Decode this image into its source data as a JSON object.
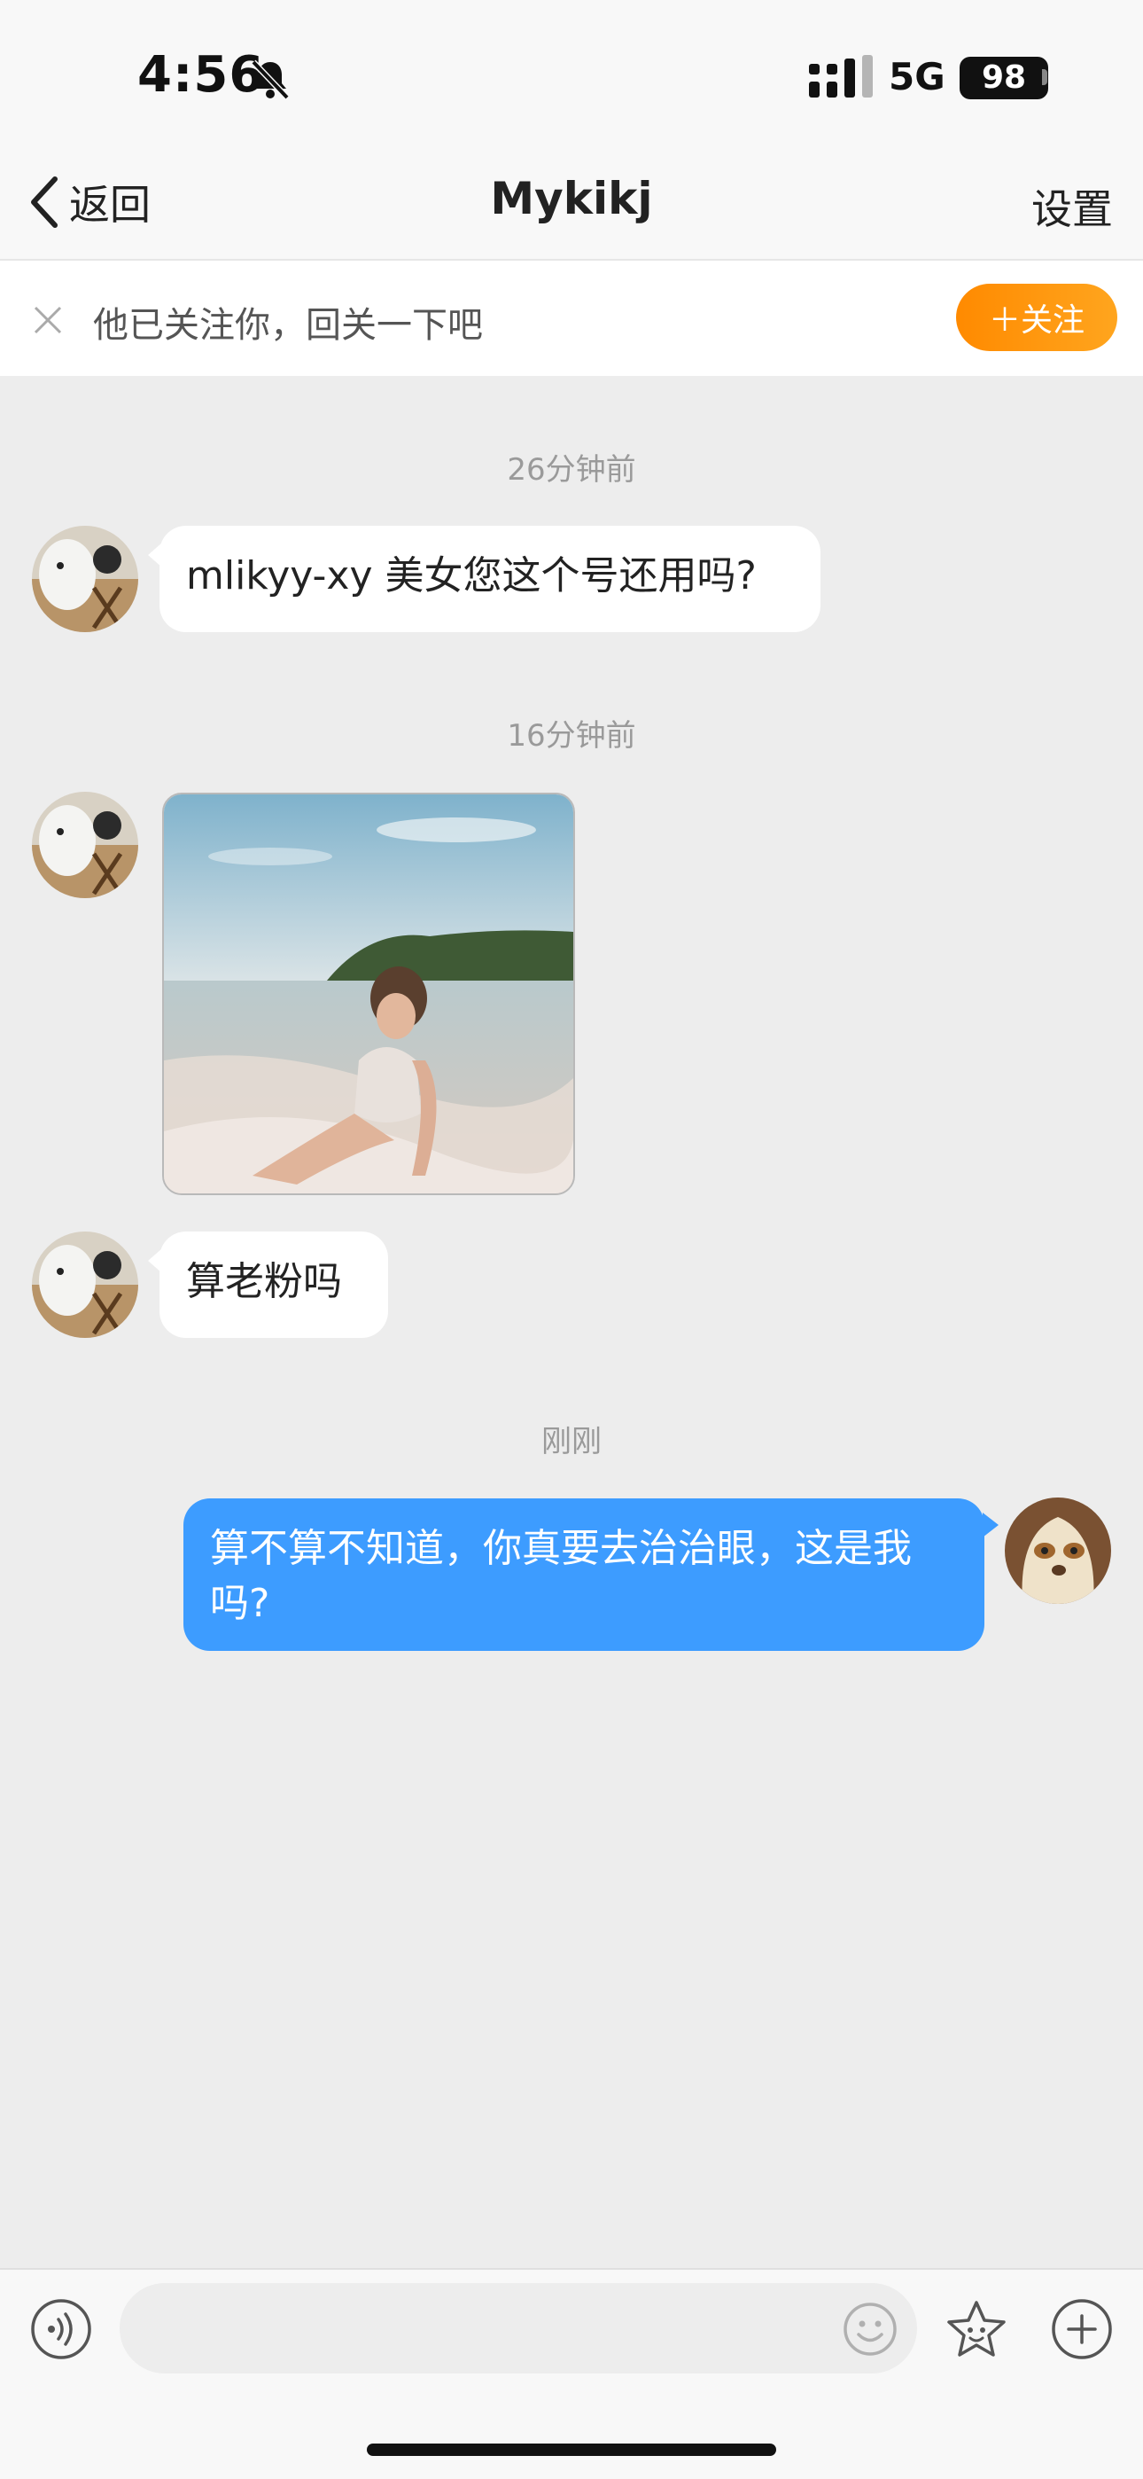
{
  "status_bar": {
    "time": "4:56",
    "network": "5G",
    "battery": "98"
  },
  "nav": {
    "back_label": "返回",
    "title": "Mykikj",
    "settings_label": "设置"
  },
  "follow_bar": {
    "text": "他已关注你，回关一下吧",
    "button_label": "＋关注"
  },
  "messages": [
    {
      "timestamp": "26分钟前"
    },
    {
      "from": "other",
      "type": "text",
      "text": "mlikyy-xy 美女您这个号还用吗?"
    },
    {
      "timestamp": "16分钟前"
    },
    {
      "from": "other",
      "type": "image"
    },
    {
      "from": "other",
      "type": "text",
      "text": "算老粉吗"
    },
    {
      "timestamp": "刚刚"
    },
    {
      "from": "me",
      "type": "text",
      "text": "算不算不知道，你真要去治治眼，这是我吗?"
    }
  ],
  "input": {
    "placeholder": ""
  },
  "colors": {
    "accent_blue": "#3d9cff",
    "follow_orange": "#ff8a00",
    "background": "#ededed"
  },
  "icons": [
    "bell-slash-icon",
    "signal-icon",
    "back-chevron-icon",
    "close-icon",
    "voice-icon",
    "emoji-icon",
    "sticker-icon",
    "plus-icon"
  ]
}
